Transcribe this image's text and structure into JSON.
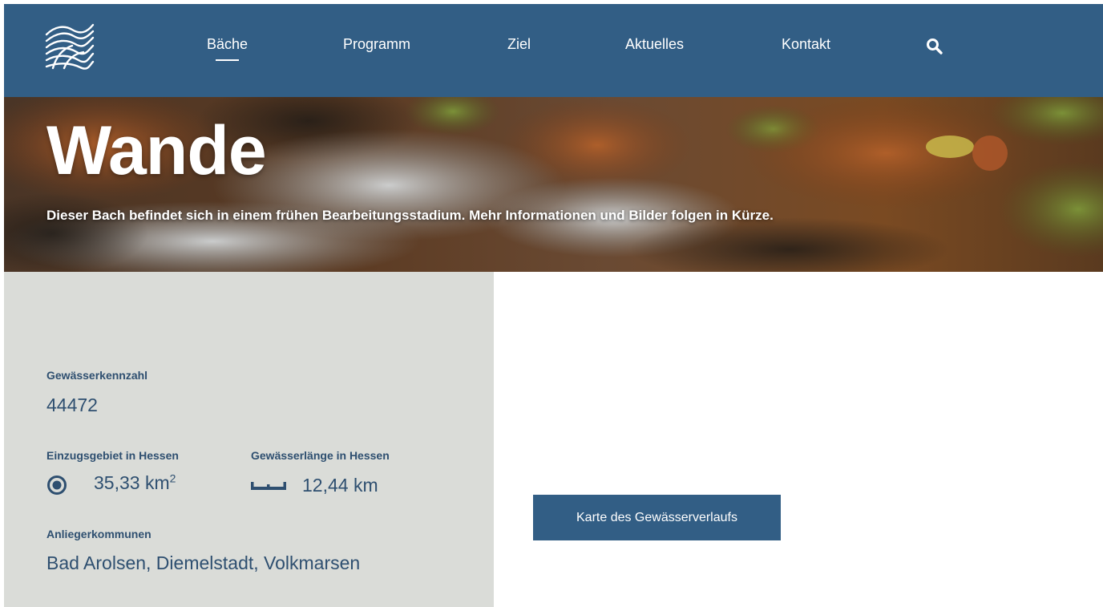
{
  "nav": {
    "items": [
      {
        "label": "Bäche",
        "active": true
      },
      {
        "label": "Programm",
        "active": false
      },
      {
        "label": "Ziel",
        "active": false
      },
      {
        "label": "Aktuelles",
        "active": false
      },
      {
        "label": "Kontakt",
        "active": false
      }
    ],
    "search_icon": "search-icon",
    "logo_icon": "stream-logo-icon"
  },
  "hero": {
    "title": "Wande",
    "subtitle": "Dieser Bach befindet sich in einem frühen Bearbeitungsstadium. Mehr Informationen und Bilder folgen in Kürze."
  },
  "info": {
    "code_label": "Gewässerkennzahl",
    "code_value": "44472",
    "area_label": "Einzugsgebiet in Hessen",
    "area_value": "35,33 km",
    "area_unit_exp": "2",
    "length_label": "Gewässerlänge in Hessen",
    "length_value": "12,44 km",
    "communities_label": "Anliegerkommunen",
    "communities_value": "Bad Arolsen, Diemelstadt, Volkmarsen"
  },
  "map_button": {
    "label": "Karte des Gewässerverlaufs"
  },
  "colors": {
    "brand": "#325e85",
    "panel": "#dadcd8",
    "text_dark": "#2e4f70"
  }
}
